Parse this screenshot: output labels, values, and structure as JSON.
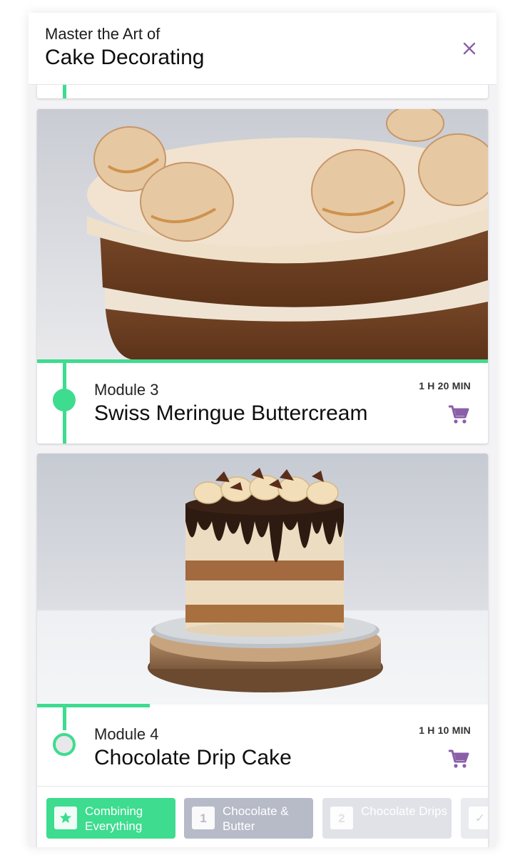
{
  "header": {
    "subtitle": "Master the Art of",
    "title": "Cake Decorating"
  },
  "modules": [
    {
      "label": "Module 3",
      "title": "Swiss Meringue Buttercream",
      "duration": "1 H 20 MIN",
      "progress": 1.0,
      "status": "completed",
      "image": "photo of layered caramel cake with piped buttercream swirls"
    },
    {
      "label": "Module 4",
      "title": "Chocolate Drip Cake",
      "duration": "1 H 10 MIN",
      "progress": 0.25,
      "status": "in-progress",
      "image": "photo of naked cake with chocolate drip on wooden board",
      "lessons": [
        {
          "badge": "★",
          "label": "Combining Everything",
          "state": "active",
          "icon": "star-icon"
        },
        {
          "badge": "1",
          "label": "Chocolate & Butter",
          "state": "inactive"
        },
        {
          "badge": "2",
          "label": "Chocolate Drips",
          "state": "inactive"
        },
        {
          "badge": "✓",
          "label": "",
          "state": "inactive",
          "icon": "check-icon"
        }
      ]
    }
  ],
  "colors": {
    "accent_green": "#3ddc8f",
    "accent_purple": "#8b5fa8",
    "chip_inactive": "#b7bbc8"
  }
}
